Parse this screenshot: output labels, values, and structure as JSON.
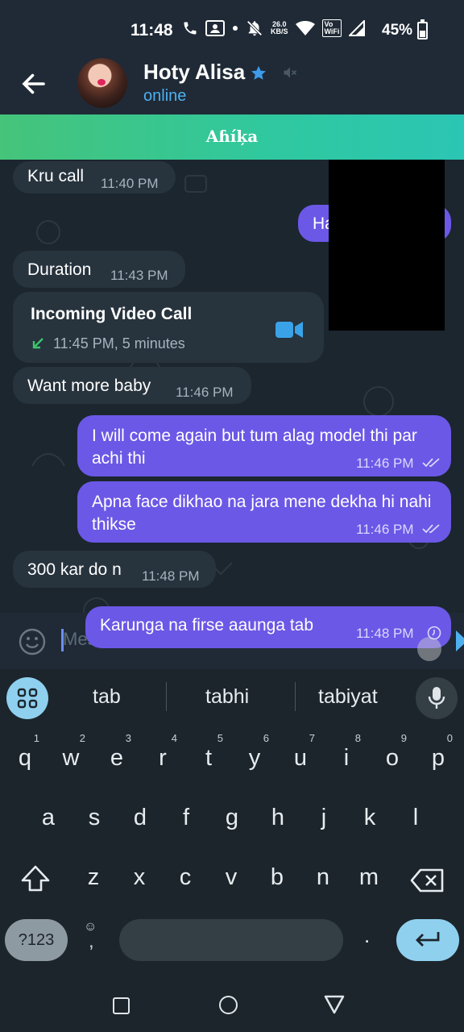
{
  "status_bar": {
    "time": "11:48",
    "net_speed_value": "26.0",
    "net_speed_unit": "KB/S",
    "volte_label_top": "Vo",
    "volte_label_bottom": "WiFi",
    "battery": "45%",
    "battery_level": 0.45,
    "icons": [
      "phone-icon",
      "contacts-icon",
      "dot-icon",
      "mute-notifications-icon",
      "wifi-icon",
      "signal-icon",
      "battery-icon"
    ]
  },
  "header": {
    "contact_name": "Hoty Alisa",
    "status": "online",
    "icons": [
      "back-arrow-icon",
      "avatar",
      "verified-star-icon",
      "muted-speaker-icon"
    ]
  },
  "banner": {
    "text": "Aɦíķa"
  },
  "messages": [
    {
      "direction": "in",
      "text": "Kru call",
      "time": "11:40 PM"
    },
    {
      "direction": "out",
      "text": "Ha",
      "time": ""
    },
    {
      "direction": "in",
      "text": "Duration",
      "time": "11:43 PM"
    },
    {
      "direction": "in",
      "type": "call",
      "title": "Incoming Video Call",
      "detail": "11:45 PM, 5 minutes"
    },
    {
      "direction": "in",
      "text": "Want more baby",
      "time": "11:46 PM"
    },
    {
      "direction": "out",
      "text": "I will come again but tum alag model thi par achi thi",
      "time": "11:46 PM",
      "status": "read"
    },
    {
      "direction": "out",
      "text": "Apna face dikhao na jara mene dekha hi nahi thikse",
      "time": "11:46 PM",
      "status": "read"
    },
    {
      "direction": "in",
      "text": "300 kar do n",
      "time": "11:48 PM"
    },
    {
      "direction": "out",
      "text": "Karunga na firse aaunga tab",
      "time": "11:48 PM",
      "status": "sending"
    }
  ],
  "input": {
    "placeholder": "Mes"
  },
  "keyboard": {
    "suggestions": [
      "tab",
      "tabhi",
      "tabiyat"
    ],
    "row1": [
      "q",
      "w",
      "e",
      "r",
      "t",
      "y",
      "u",
      "i",
      "o",
      "p"
    ],
    "row1_hints": [
      "1",
      "2",
      "3",
      "4",
      "5",
      "6",
      "7",
      "8",
      "9",
      "0"
    ],
    "row2": [
      "a",
      "s",
      "d",
      "f",
      "g",
      "h",
      "j",
      "k",
      "l"
    ],
    "row3": [
      "z",
      "x",
      "c",
      "v",
      "b",
      "n",
      "m"
    ],
    "symbols_label": "?123",
    "comma_label": ",",
    "period_label": ".",
    "emoji_hint": "☺"
  },
  "colors": {
    "incoming_bubble": "#27333d",
    "outgoing_bubble": "#6b58e6",
    "online_text": "#4fb0f0",
    "banner_green": "#45c47a",
    "video_call_icon": "#3aa3e8",
    "incoming_arrow": "#3bc56c"
  }
}
